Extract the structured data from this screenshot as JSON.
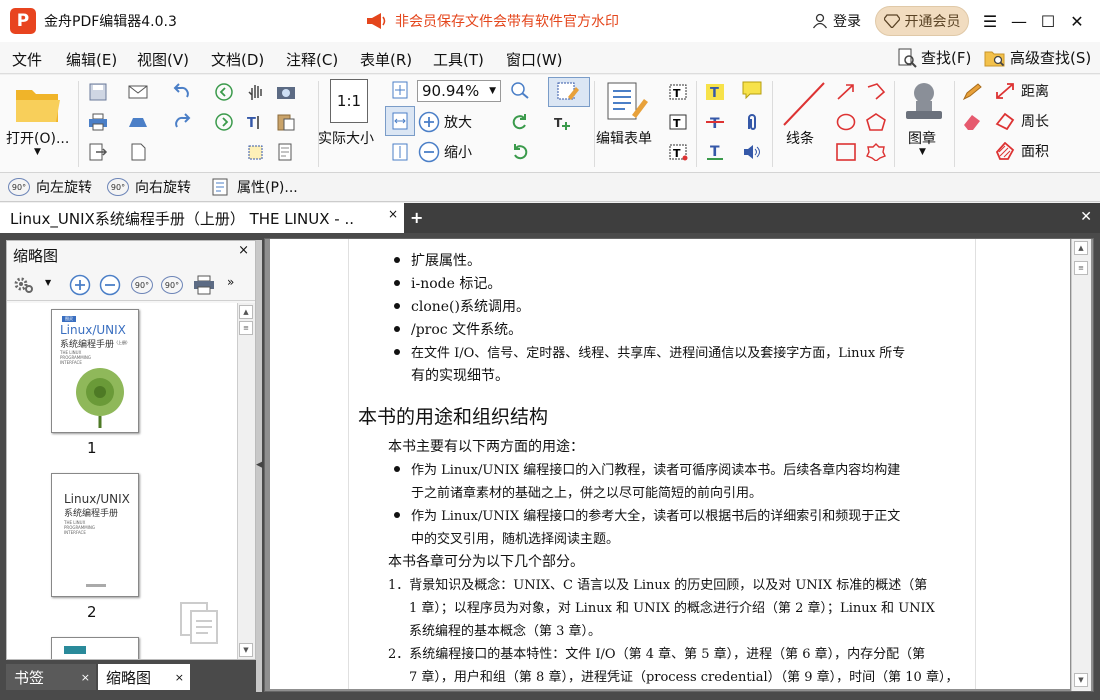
{
  "app": {
    "title": "金舟PDF编辑器4.0.3",
    "logo_letter": "P",
    "watermark_notice": "非会员保存文件会带有软件官方水印",
    "login_label": "登录",
    "vip_label": "开通会员",
    "accent": "#e4461c"
  },
  "menu": {
    "items": [
      "文件",
      "编辑(E)",
      "视图(V)",
      "文档(D)",
      "注释(C)",
      "表单(R)",
      "工具(T)",
      "窗口(W)"
    ],
    "search_label": "查找(F)",
    "advanced_search_label": "高级查找(S)"
  },
  "ribbon": {
    "open_label": "打开(O)...",
    "actual_size_label": "实际大小",
    "zoom_value": "90.94%",
    "zoom_in_label": "放大",
    "zoom_out_label": "缩小",
    "edit_form_label": "编辑表单",
    "lines_label": "线条",
    "stamp_label": "图章",
    "distance_label": "距离",
    "perimeter_label": "周长",
    "area_label": "面积"
  },
  "toolbar2": {
    "rotate_left": "向左旋转",
    "rotate_right": "向右旋转",
    "properties": "属性(P)..."
  },
  "tab": {
    "title": "Linux_UNIX系统编程手册（上册） THE LINUX  - ..",
    "close": "×"
  },
  "sidebar": {
    "title": "缩略图",
    "close": "×",
    "pages": [
      "1",
      "2"
    ],
    "cover_badge": "图灵",
    "cover_title_1": "Linux/UNIX",
    "cover_title_2": "系统编程手册",
    "cover_title_small": "（上册）",
    "cover_en": "THE LINUX PROGRAMMING INTERFACE"
  },
  "bottom_tabs": {
    "bookmarks": "书签",
    "thumbnails": "缩略图",
    "close": "×"
  },
  "document": {
    "lines": [
      "扩展属性。",
      "i-node 标记。",
      "clone()系统调用。",
      "/proc 文件系统。",
      "在文件 I/O、信号、定时器、线程、共享库、进程间通信以及套接字方面，Linux 所专",
      "有的实现细节。"
    ],
    "heading": "本书的用途和组织结构",
    "para1": "本书主要有以下两方面的用途：",
    "b1a": "作为 Linux/UNIX 编程接口的入门教程，读者可循序阅读本书。后续各章内容均构建",
    "b1b": "于之前诸章素材的基础之上，併之以尽可能简短的前向引用。",
    "b2a": "作为 Linux/UNIX 编程接口的参考大全，读者可以根据书后的详细索引和频现于正文",
    "b2b": "中的交叉引用，随机选择阅读主题。",
    "para2": "本书各章可分为以下几个部分。",
    "n1a": "1．背景知识及概念：UNIX、C 语言以及 Linux 的历史回顾，以及对 UNIX 标准的概述（第",
    "n1b": "1 章）；以程序员为对象，对 Linux 和 UNIX 的概念进行介绍（第 2 章）；Linux 和 UNIX",
    "n1c": "系统编程的基本概念（第 3 章）。",
    "n2a": "2．系统编程接口的基本特性：文件 I/O（第 4 章、第 5 章），进程（第 6 章），内存分配（第",
    "n2b": "7 章），用户和组（第 8 章），进程凭证（process credential）（第 9 章），时间（第 10 章），"
  }
}
